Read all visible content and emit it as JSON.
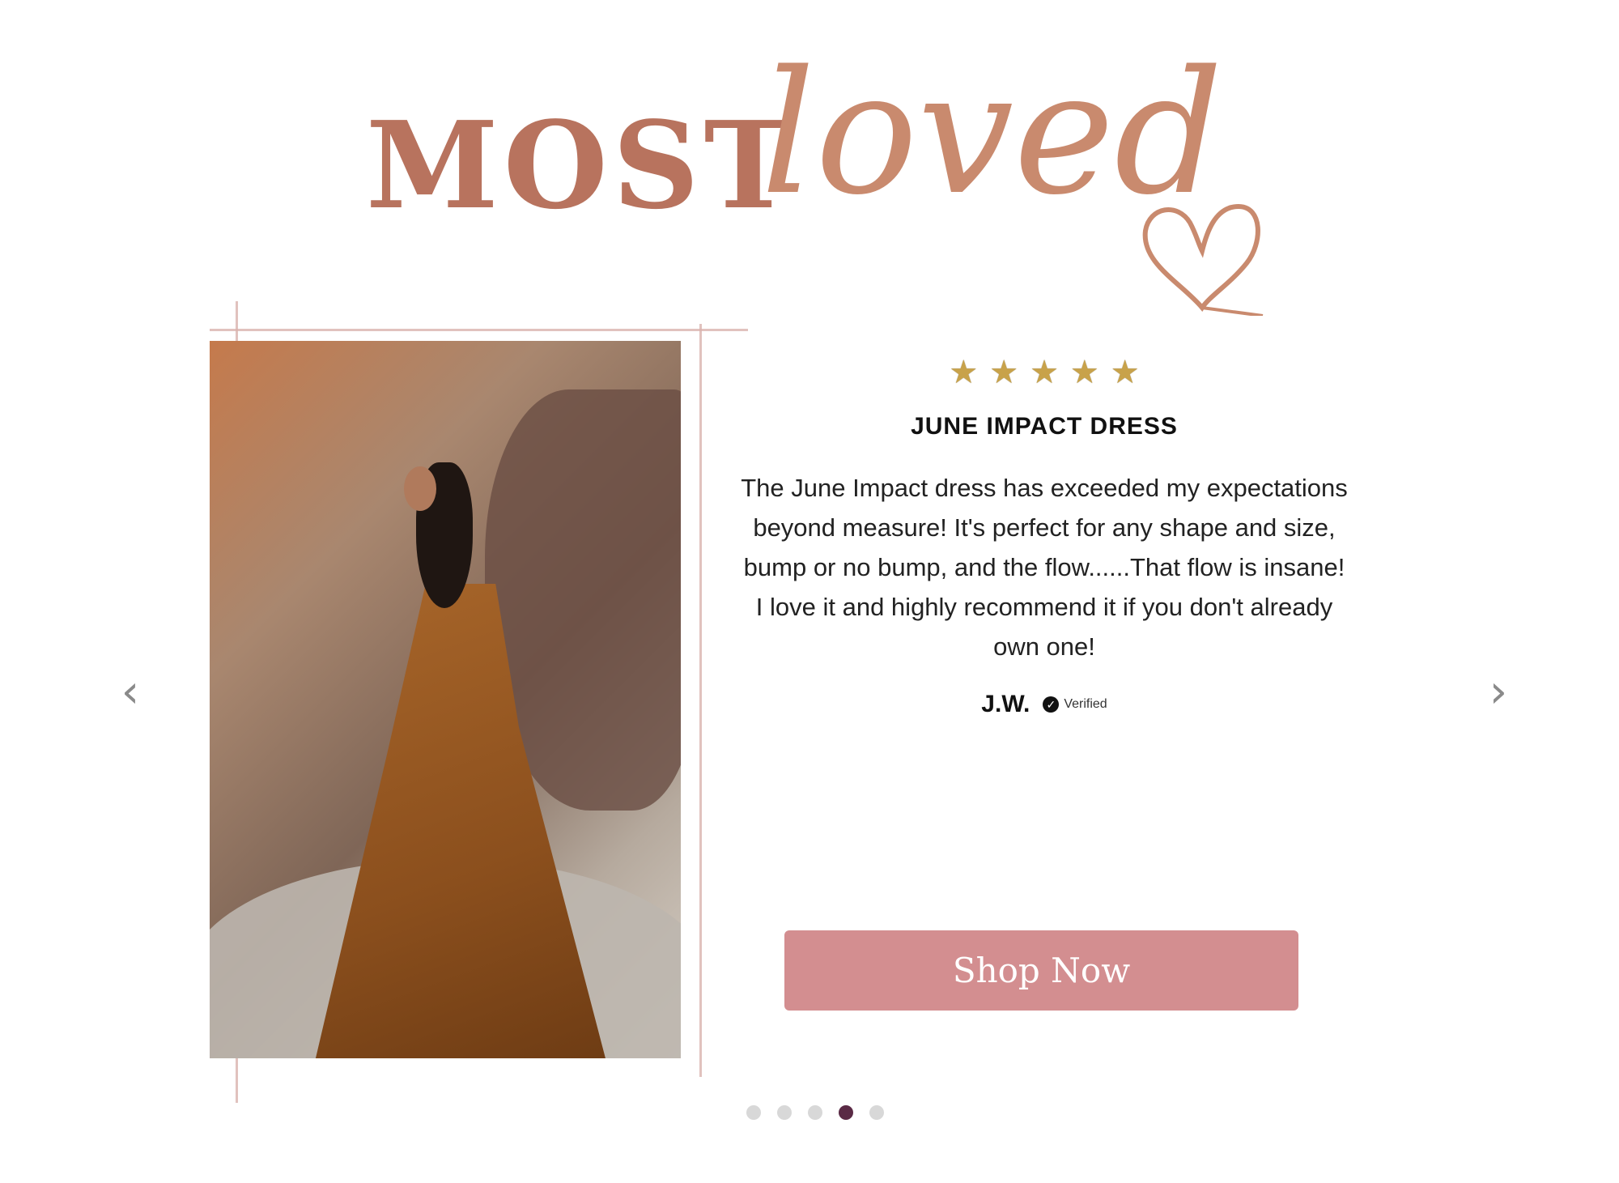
{
  "heading": {
    "most": "MOST",
    "loved": "loved"
  },
  "review": {
    "rating": 5,
    "product_title": "JUNE IMPACT DRESS",
    "text": "The June Impact dress has exceeded my expectations beyond measure! It's perfect for any shape and size, bump or no bump, and the flow......That flow is insane! I love it and highly recommend it if you don't already own one!",
    "author": "J.W.",
    "verified_label": "Verified"
  },
  "shop_button": {
    "label": "Shop Now"
  },
  "carousel": {
    "prev_icon": "chevron-left-icon",
    "next_icon": "chevron-right-icon",
    "dots_total": 5,
    "active_index": 3
  },
  "colors": {
    "accent_button": "#d38e90",
    "active_dot": "#5a2a45",
    "heading_rose_gold": "#b8735e"
  }
}
